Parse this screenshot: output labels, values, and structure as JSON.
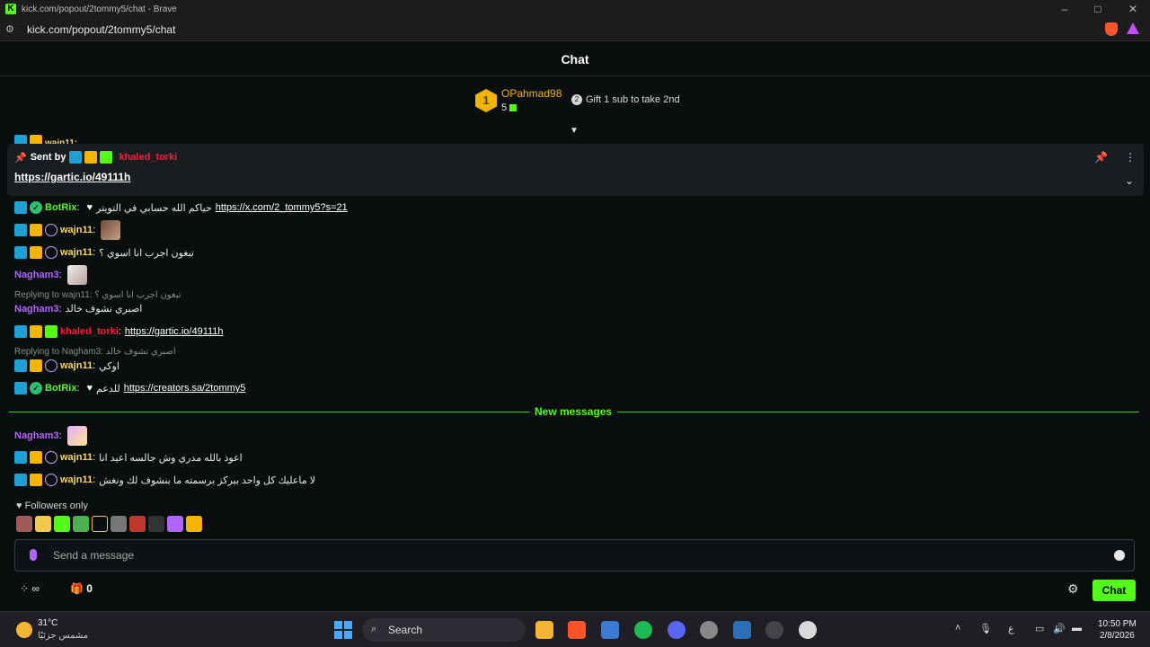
{
  "browser": {
    "window_title": "kick.com/popout/2tommy5/chat - Brave",
    "url": "kick.com/popout/2tommy5/chat"
  },
  "chat": {
    "title": "Chat",
    "leaderboard": {
      "rank": "1",
      "username": "OPahmad98",
      "gift_count": "5",
      "next_rank": "2",
      "gift_prompt": "Gift 1 sub to take 2nd"
    },
    "peek_user": "wajn11:",
    "pinned": {
      "sent_by": "Sent by",
      "author": "khaled_torki",
      "link": "https://gartic.io/49111h"
    },
    "messages": [
      {
        "user": "BotRix",
        "text": "حياكم الله حسابي في التويتر",
        "link": "https://x.com/2_tommy5?s=21"
      },
      {
        "user": "wajn11",
        "text": ""
      },
      {
        "user": "wajn11",
        "text": "تبغون اجرب انا اسوي ؟"
      },
      {
        "user": "Nagham3",
        "text": ""
      },
      {
        "reply": "Replying to wajn11: تبغون اجرب انا اسوي ؟",
        "user": "Nagham3",
        "text": "اصبري نشوف خالد"
      },
      {
        "user": "khaled_torki",
        "link": "https://gartic.io/49111h"
      },
      {
        "reply": "Replying to Nagham3: اصبري نشوف خالد",
        "user": "wajn11",
        "text": "اوكي"
      },
      {
        "user": "BotRix",
        "text": "للدعم",
        "link": "https://creators.sa/2tommy5"
      }
    ],
    "new_messages_label": "New messages",
    "new_messages": [
      {
        "user": "Nagham3",
        "text": ""
      },
      {
        "user": "wajn11",
        "text": "اعوذ بالله مدري وش جالسه اعيد انا"
      },
      {
        "user": "wajn11",
        "text": "لا ماعليك كل واحد بيركز برسمته ما بنشوف لك ونغش"
      }
    ],
    "followers_only": "Followers only",
    "input_placeholder": "Send a message",
    "points_symbol": "∞",
    "gift_count": "0",
    "chat_button": "Chat"
  },
  "taskbar": {
    "temperature": "31°C",
    "weather_desc": "مشمس جزئيًا",
    "search_label": "Search",
    "lang": "ع",
    "time": "10:50 PM",
    "date": "2/8/2026"
  },
  "colors": {
    "kick_green": "#53fc18",
    "gold": "#f5b400",
    "purple": "#b264ff",
    "red": "#ff1a3c"
  }
}
